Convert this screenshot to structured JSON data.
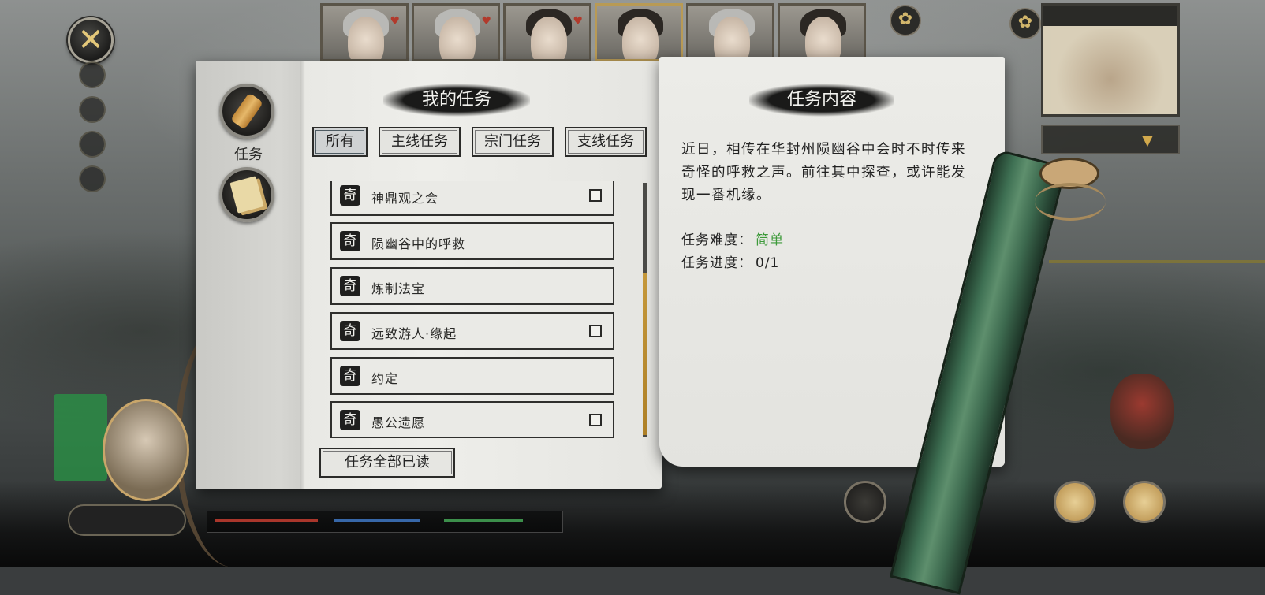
{
  "header": {
    "close_icon": "close-icon",
    "portraits": [
      {
        "name": "portrait-1",
        "style": "grey"
      },
      {
        "name": "portrait-2",
        "style": "grey"
      },
      {
        "name": "portrait-3",
        "style": "dark"
      },
      {
        "name": "portrait-4",
        "style": "dark",
        "active": true
      },
      {
        "name": "portrait-5",
        "style": "grey"
      },
      {
        "name": "portrait-6",
        "style": "dark"
      }
    ]
  },
  "sidebar": {
    "quest_icon": "scroll-icon",
    "quest_label": "任务",
    "letter_icon": "letter-icon"
  },
  "quest_panel": {
    "title": "我的任务",
    "tabs": [
      {
        "label": "所有",
        "active": true
      },
      {
        "label": "主线任务",
        "active": false
      },
      {
        "label": "宗门任务",
        "active": false
      },
      {
        "label": "支线任务",
        "active": false
      }
    ],
    "items": [
      {
        "badge": "奇",
        "title": "神鼎观之会",
        "has_checkbox": true
      },
      {
        "badge": "奇",
        "title": "陨幽谷中的呼救",
        "has_checkbox": false
      },
      {
        "badge": "奇",
        "title": "炼制法宝",
        "has_checkbox": false
      },
      {
        "badge": "奇",
        "title": "远致游人·缘起",
        "has_checkbox": true
      },
      {
        "badge": "奇",
        "title": "约定",
        "has_checkbox": false
      },
      {
        "badge": "奇",
        "title": "愚公遗愿",
        "has_checkbox": true
      }
    ],
    "read_all_label": "任务全部已读"
  },
  "detail_panel": {
    "title": "任务内容",
    "description": "近日，相传在华封州陨幽谷中会时不时传来奇怪的呼救之声。前往其中探查，或许能发现一番机缘。",
    "difficulty_label": "任务难度：",
    "difficulty_value": "简单",
    "progress_label": "任务进度：",
    "progress_value": "0/1"
  },
  "colors": {
    "difficulty_easy": "#3d9a3a",
    "scroll_thumb": "#c79a3c",
    "ink": "#1a1a19"
  }
}
